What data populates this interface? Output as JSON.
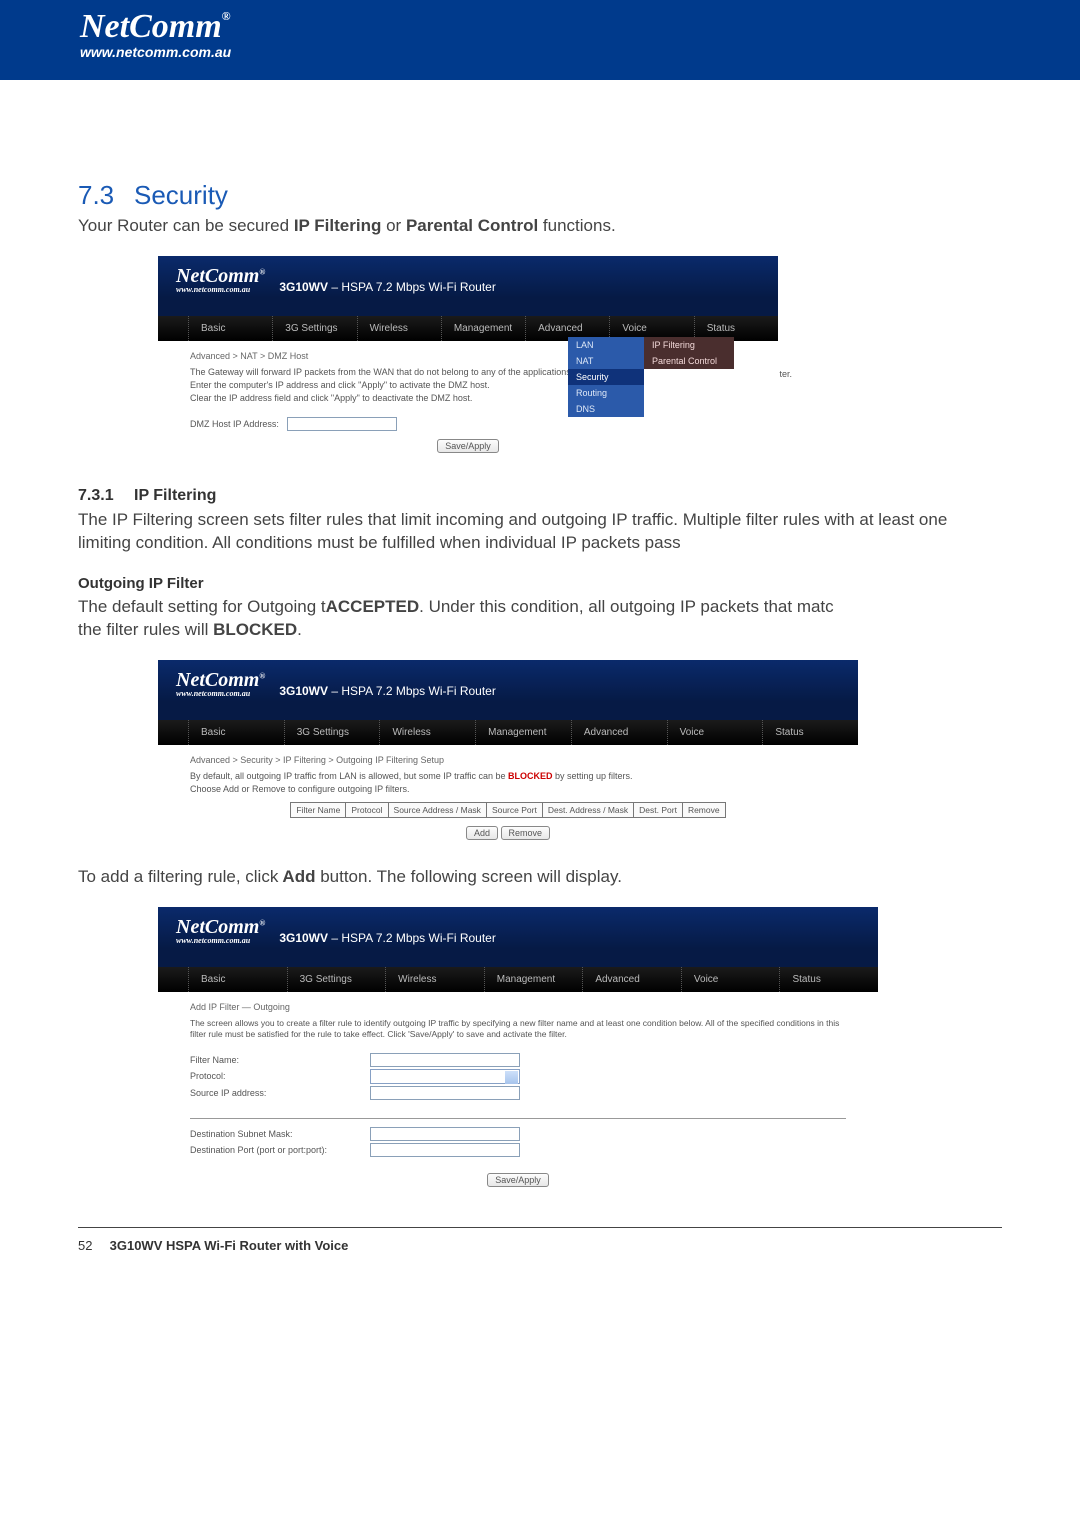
{
  "header": {
    "brand": "NetComm",
    "reg": "®",
    "url": "www.netcomm.com.au"
  },
  "section": {
    "num": "7.3",
    "title": "Security",
    "intro_a": "Your Router can be secured",
    "intro_b": "IP Filtering",
    "intro_c": " or ",
    "intro_d": "Parental Control",
    "intro_e": " functions."
  },
  "router_common": {
    "logo": "NetComm",
    "url": "www.netcomm.com.au",
    "title_bold": "3G10WV",
    "title_rest": " – HSPA 7.2 Mbps Wi-Fi Router",
    "nav": [
      "Basic",
      "3G Settings",
      "Wireless",
      "Management",
      "Advanced",
      "Voice",
      "Status"
    ]
  },
  "screenshot_a": {
    "crumb": "Advanced > NAT > DMZ Host",
    "line1": "The Gateway will forward IP packets from the WAN that do not belong to any of the applications configur",
    "line1_tail": "ter.",
    "line2": "Enter the computer's IP address and click \"Apply\" to activate the DMZ host.",
    "line3": "Clear the IP address field and click \"Apply\" to deactivate the DMZ host.",
    "label_ip": "DMZ Host IP Address:",
    "btn": "Save/Apply",
    "menu1": [
      "LAN",
      "NAT",
      "Security",
      "Routing",
      "DNS"
    ],
    "menu2": [
      "IP Filtering",
      "Parental Control"
    ]
  },
  "sub1": {
    "num": "7.3.1",
    "title": "IP Filtering",
    "text": "The IP Filtering screen sets filter rules that limit incoming and outgoing IP traffic. Multiple filter rules with at least one limiting condition. All conditions must be fulfilled when individual IP packets pass"
  },
  "outgoing": {
    "heading": "Outgoing IP Filter",
    "p1a": "The default setting for Outgoing t",
    "p1b": "ACCEPTED",
    "p1c": ". Under this condition, all outgoing IP packets that matc",
    "p2a": "the filter rules will ",
    "p2b": "BLOCKED",
    "p2c": "."
  },
  "screenshot_b": {
    "crumb": "Advanced > Security > IP Filtering > Outgoing IP Filtering Setup",
    "line1a": "By default, all outgoing IP traffic from LAN is allowed, but some IP traffic can be ",
    "line1b": "BLOCKED",
    "line1c": " by setting up filters.",
    "line2": "Choose Add or Remove to configure outgoing IP filters.",
    "cols": [
      "Filter Name",
      "Protocol",
      "Source Address / Mask",
      "Source Port",
      "Dest. Address / Mask",
      "Dest. Port",
      "Remove"
    ],
    "btn_add": "Add",
    "btn_remove": "Remove"
  },
  "mid_text": {
    "a": "To add a filtering rule, click",
    "b": " Add ",
    "c": "button. The following screen will display."
  },
  "screenshot_c": {
    "heading": "Add IP Filter — Outgoing",
    "desc": "The screen allows you to create a filter rule to identify outgoing IP traffic by specifying a new filter name and at least one condition below. All of the specified conditions in this filter rule must be satisfied for the rule to take effect. Click 'Save/Apply' to save and activate the filter.",
    "labels": {
      "filter_name": "Filter Name:",
      "protocol": "Protocol:",
      "src_ip": "Source IP address:",
      "dst_mask": "Destination Subnet Mask:",
      "dst_port": "Destination Port (port or port:port):"
    },
    "btn": "Save/Apply"
  },
  "footer": {
    "page": "52",
    "model": "3G10WV HSPA Wi-Fi Router with Voice"
  }
}
